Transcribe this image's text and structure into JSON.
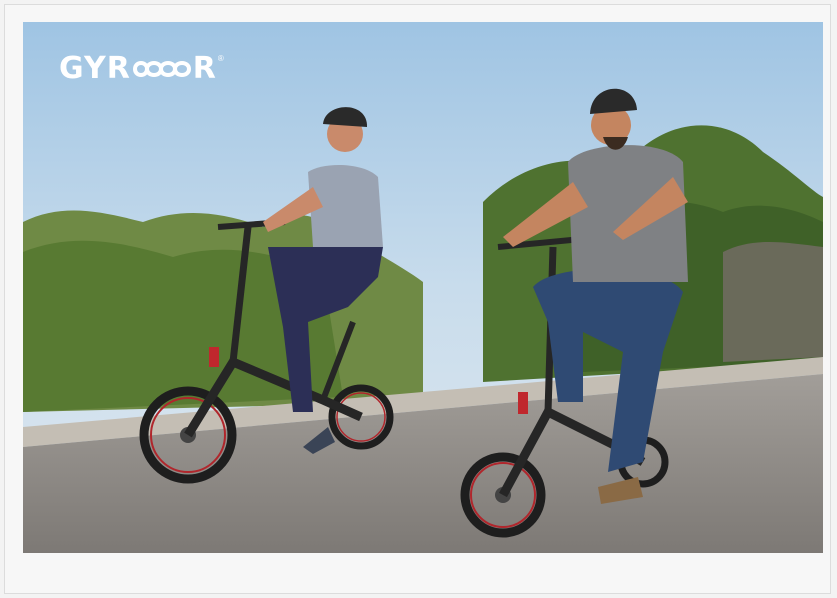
{
  "photo": {
    "subject": "two-riders-on-folding-ebikes",
    "logo": {
      "left_text": "GYR",
      "right_text": "R",
      "mark": "∞",
      "trademark": "®"
    }
  },
  "colors": {
    "sky": "#bcd6ea",
    "road": "#8f8b87",
    "foliage": "#5e7d3a",
    "bike_frame": "#262626",
    "wheel_rim_accent": "#b0262c"
  }
}
